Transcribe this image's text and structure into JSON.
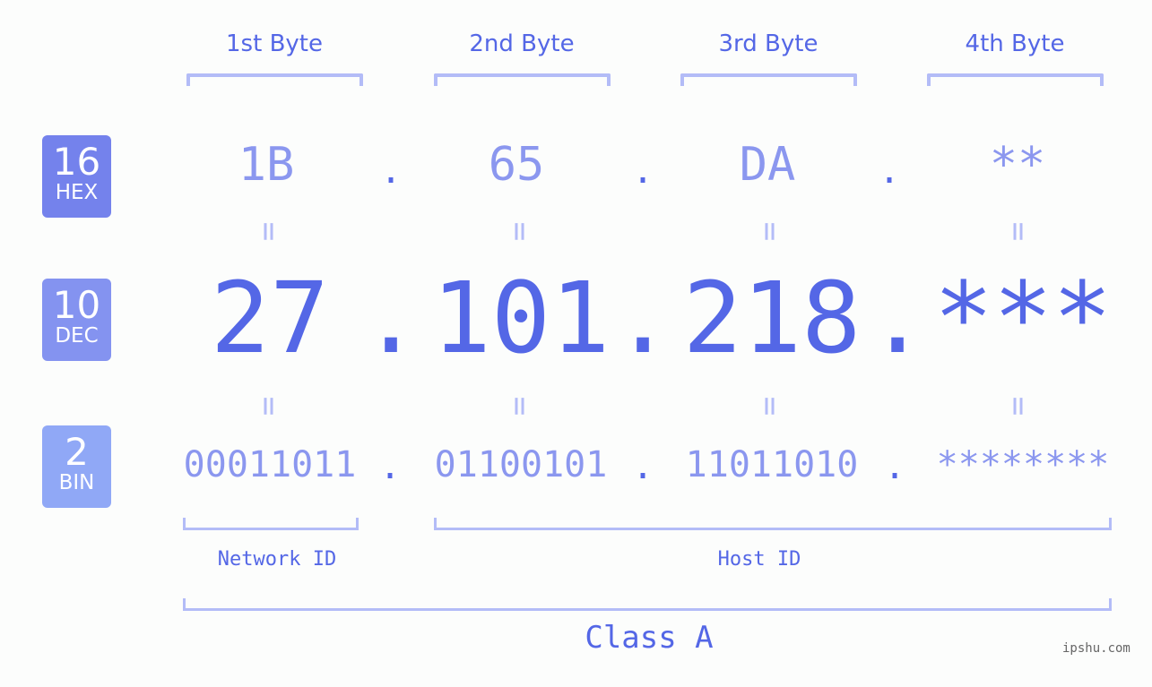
{
  "byte_headers": [
    "1st Byte",
    "2nd Byte",
    "3rd Byte",
    "4th Byte"
  ],
  "badges": [
    {
      "num": "16",
      "label": "HEX",
      "color": "#7482ec"
    },
    {
      "num": "10",
      "label": "DEC",
      "color": "#8493f0"
    },
    {
      "num": "2",
      "label": "BIN",
      "color": "#90a8f6"
    }
  ],
  "hex": [
    "1B",
    "65",
    "DA",
    "**"
  ],
  "dec": [
    "27",
    "101",
    "218",
    "***"
  ],
  "bin": [
    "00011011",
    "01100101",
    "11011010",
    "********"
  ],
  "separator": ".",
  "equals": "=",
  "network_label": "Network ID",
  "host_label": "Host ID",
  "class_label": "Class A",
  "watermark": "ipshu.com",
  "colors": {
    "accent": "#5467e6",
    "light": "#8b97ef",
    "bracket": "#b3bcf7"
  }
}
